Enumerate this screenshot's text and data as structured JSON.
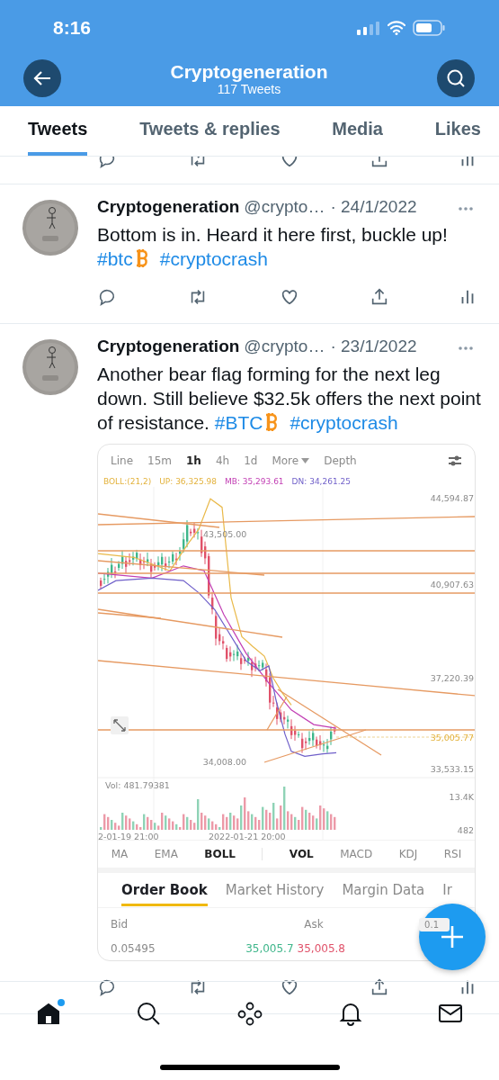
{
  "status_bar": {
    "time": "8:16"
  },
  "header": {
    "title": "Cryptogeneration",
    "subtitle": "117 Tweets"
  },
  "tabs": [
    {
      "label": "Tweets",
      "selected": true
    },
    {
      "label": "Tweets & replies",
      "selected": false
    },
    {
      "label": "Media",
      "selected": false
    },
    {
      "label": "Likes",
      "selected": false
    }
  ],
  "tweets": [
    {
      "name": "Cryptogeneration",
      "handle": "@crypto…",
      "date": "· 24/1/2022",
      "text": [
        {
          "kind": "text",
          "text": "Bottom is in. Heard it here first, buckle up! "
        },
        {
          "kind": "hashtag",
          "text": "#btc"
        },
        {
          "kind": "bitcoin"
        },
        {
          "kind": "hashtag",
          "text": "#cryptocrash"
        }
      ]
    },
    {
      "name": "Cryptogeneration",
      "handle": "@crypto…",
      "date": "· 23/1/2022",
      "text": [
        {
          "kind": "text",
          "text": "Another bear flag forming for the next leg down. Still believe $32.5k offers the next point of resistance. "
        },
        {
          "kind": "hashtag",
          "text": "#BTC"
        },
        {
          "kind": "bitcoin"
        },
        {
          "kind": "hashtag",
          "text": "#cryptocrash"
        }
      ],
      "media": {
        "intervals": [
          {
            "label": "Line",
            "selected": false
          },
          {
            "label": "15m",
            "selected": false
          },
          {
            "label": "1h",
            "selected": true
          },
          {
            "label": "4h",
            "selected": false
          },
          {
            "label": "1d",
            "selected": false
          }
        ],
        "more": "More",
        "depth": "Depth",
        "boll": {
          "label": "BOLL:(21,2)",
          "up": "UP: 36,325.98",
          "mb": "MB: 35,293.61",
          "dn": "DN: 34,261.25"
        },
        "price_axis": [
          "44,594.87",
          "40,907.63",
          "37,220.39",
          "33,533.15"
        ],
        "high": "43,505.00",
        "low": "34,008.00",
        "last": "35,005.77",
        "volume": {
          "label": "Vol: 481.79381",
          "ticks": [
            "13.4K",
            "482"
          ]
        },
        "times": [
          "2-01-19 21:00",
          "2022-01-21 20:00"
        ],
        "indicators": [
          {
            "label": "MA",
            "selected": false
          },
          {
            "label": "EMA",
            "selected": false
          },
          {
            "label": "BOLL",
            "selected": true
          },
          {
            "label": "VOL",
            "selected": true
          },
          {
            "label": "MACD",
            "selected": false
          },
          {
            "label": "KDJ",
            "selected": false
          },
          {
            "label": "RSI",
            "selected": false
          }
        ],
        "book_tabs": [
          {
            "label": "Order Book",
            "selected": true
          },
          {
            "label": "Market History",
            "selected": false
          },
          {
            "label": "Margin Data",
            "selected": false
          },
          {
            "label": "Ir",
            "selected": false
          }
        ],
        "book": {
          "bid": "Bid",
          "ask": "Ask",
          "step": "0.1",
          "bid_amount": "0.05495",
          "bid_price": "35,005.7",
          "ask_price": "35,005.8"
        }
      }
    }
  ],
  "bottom_nav": [
    {
      "kind": "home",
      "selected": true,
      "badge": true
    },
    {
      "kind": "search",
      "selected": false,
      "badge": false
    },
    {
      "kind": "spaces",
      "selected": false,
      "badge": false
    },
    {
      "kind": "notifications",
      "selected": false,
      "badge": false
    },
    {
      "kind": "messages",
      "selected": false,
      "badge": false
    }
  ]
}
